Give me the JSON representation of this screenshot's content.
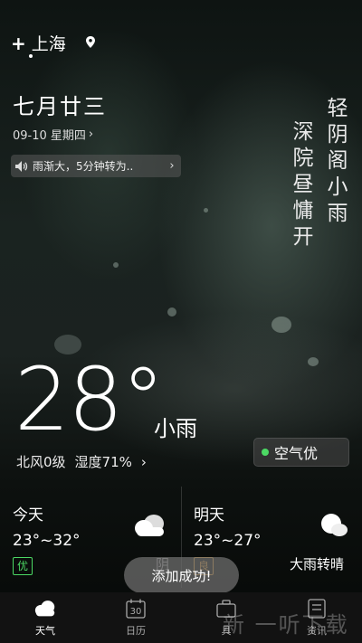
{
  "location": {
    "city": "上海",
    "add_symbol": "+"
  },
  "date": {
    "lunar": "七月廿三",
    "gregorian": "09-10 星期四",
    "chevron": "›"
  },
  "alert": {
    "text": "雨渐大，5分钟转为..",
    "chevron": "›"
  },
  "poem": {
    "col1": "轻阴阁小雨",
    "col2": "深院昼慵开"
  },
  "current": {
    "temperature": "28°",
    "condition": "小雨",
    "wind": "北风0级",
    "humidity": "湿度71%",
    "chevron": "›",
    "aqi": "空气优"
  },
  "forecast": [
    {
      "day": "今天",
      "range": "23°~32°",
      "quality": "优",
      "desc": "阴"
    },
    {
      "day": "明天",
      "range": "23°~27°",
      "quality": "良",
      "desc": "大雨转晴"
    }
  ],
  "toast": "添加成功!",
  "tabs": [
    {
      "label": "天气",
      "icon": "cloud-icon",
      "active": true
    },
    {
      "label": "日历",
      "icon": "calendar-icon",
      "day": "30",
      "active": false
    },
    {
      "label": "具",
      "icon": "toolbox-icon",
      "active": false
    },
    {
      "label": "资讯",
      "icon": "news-icon",
      "active": false
    }
  ],
  "watermark": "新 一听下载",
  "colors": {
    "aqi_good": "#4cd964",
    "quality_good": "#4cd964",
    "quality_fair": "#e6a23c"
  }
}
